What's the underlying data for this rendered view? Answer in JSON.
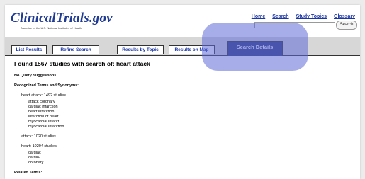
{
  "site": {
    "logo": "ClinicalTrials.gov",
    "tagline": "A service of the U.S. National Institutes of Health"
  },
  "toplinks": [
    "Home",
    "Search",
    "Study Topics",
    "Glossary"
  ],
  "search": {
    "button_label": "Search",
    "value": ""
  },
  "tabs": {
    "list_results": "List Results",
    "refine_search": "Refine Search",
    "results_by_topic": "Results by Topic",
    "results_on_map": "Results on Map",
    "search_details": "Search Details"
  },
  "main": {
    "heading": "Found 1567 studies with search of:  heart attack",
    "no_query_suggestions": "No Query Suggestions",
    "recognized_terms_label": "Recognized Terms and Synonyms:",
    "groups": [
      {
        "title": "heart attack:   1492 studies",
        "synonyms": [
          "attack coronary",
          "cardiac infarction",
          "heart infarction",
          "infarction of heart",
          "myocardial infarct",
          "myocardial infarction"
        ]
      },
      {
        "title": "attack:   1020 studies",
        "synonyms": []
      },
      {
        "title": "heart:   10204 studies",
        "synonyms": [
          "cardiac",
          "cardio-",
          "coronary"
        ]
      }
    ],
    "related_terms_label": "Related Terms:"
  },
  "colors": {
    "link": "#1a35a8",
    "logo": "#1f3a93",
    "tab_active_bg": "#2f3a7a",
    "tabbar_bg": "#d7d7d7",
    "highlight": "rgba(95,105,215,0.55)"
  }
}
